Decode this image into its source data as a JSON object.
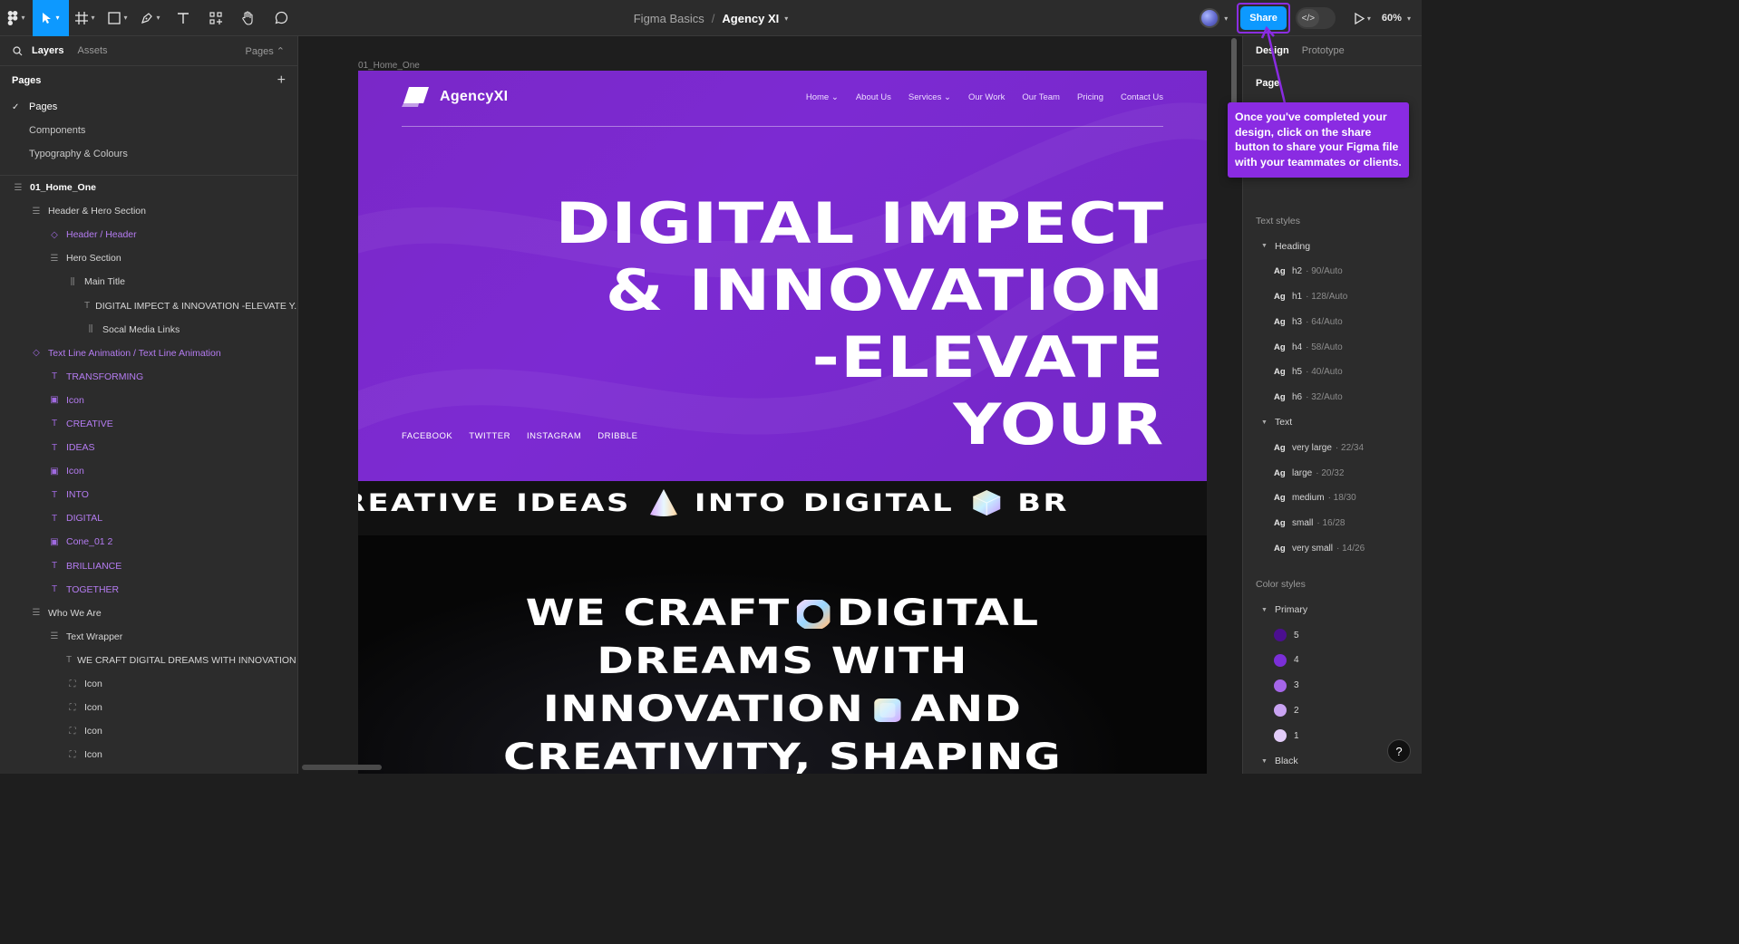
{
  "toolbar": {
    "breadcrumb_project": "Figma Basics",
    "breadcrumb_separator": "/",
    "file_name": "Agency XI",
    "share_label": "Share",
    "dev_mode_label": "</>",
    "zoom": "60%"
  },
  "left_panel": {
    "tab_layers": "Layers",
    "tab_assets": "Assets",
    "pages_dropdown": "Pages ⌃",
    "pages_heading": "Pages",
    "add_page": "+",
    "pages": [
      "Pages",
      "Components",
      "Typography & Colours"
    ],
    "selected_page_check": "✓",
    "layers": [
      {
        "label": "01_Home_One",
        "icon": "frame-icon",
        "indent": 0
      },
      {
        "label": "Header & Hero Section",
        "icon": "auto-layout-icon",
        "indent": 1
      },
      {
        "label": "Header / Header",
        "icon": "component-instance-icon",
        "indent": 2
      },
      {
        "label": "Hero Section",
        "icon": "auto-layout-icon",
        "indent": 2
      },
      {
        "label": "Main Title",
        "icon": "auto-layout-horizontal-icon",
        "indent": 3
      },
      {
        "label": "DIGITAL IMPECT & INNOVATION -ELEVATE Y...",
        "icon": "text-icon",
        "indent": 4
      },
      {
        "label": "Socal Media Links",
        "icon": "auto-layout-horizontal-icon",
        "indent": 4
      },
      {
        "label": "Text Line Animation / Text Line Animation",
        "icon": "component-instance-icon",
        "indent": 1
      },
      {
        "label": "TRANSFORMING",
        "icon": "text-icon",
        "indent": 2
      },
      {
        "label": "Icon",
        "icon": "image-icon",
        "indent": 2
      },
      {
        "label": "CREATIVE",
        "icon": "text-icon",
        "indent": 2
      },
      {
        "label": "IDEAS",
        "icon": "text-icon",
        "indent": 2
      },
      {
        "label": "Icon",
        "icon": "image-icon",
        "indent": 2
      },
      {
        "label": "INTO",
        "icon": "text-icon",
        "indent": 2
      },
      {
        "label": "DIGITAL",
        "icon": "text-icon",
        "indent": 2
      },
      {
        "label": "Cone_01 2",
        "icon": "image-icon",
        "indent": 2
      },
      {
        "label": "BRILLIANCE",
        "icon": "text-icon",
        "indent": 2
      },
      {
        "label": "TOGETHER",
        "icon": "text-icon",
        "indent": 2
      },
      {
        "label": "Who We Are",
        "icon": "auto-layout-icon",
        "indent": 1
      },
      {
        "label": "Text Wrapper",
        "icon": "auto-layout-icon",
        "indent": 2
      },
      {
        "label": "WE CRAFT DIGITAL DREAMS WITH INNOVATION ...",
        "icon": "text-icon",
        "indent": 3
      },
      {
        "label": "Icon",
        "icon": "image-frame-icon",
        "indent": 3
      },
      {
        "label": "Icon",
        "icon": "image-frame-icon",
        "indent": 3
      },
      {
        "label": "Icon",
        "icon": "image-frame-icon",
        "indent": 3
      },
      {
        "label": "Icon",
        "icon": "image-frame-icon",
        "indent": 3
      }
    ]
  },
  "canvas": {
    "frame_label": "01_Home_One",
    "site": {
      "logo_text": "AgencyXI",
      "nav": [
        "Home ⌄",
        "About Us",
        "Services ⌄",
        "Our Work",
        "Our Team",
        "Pricing",
        "Contact Us"
      ],
      "hero_lines": [
        "DIGITAL IMPECT",
        "& INNOVATION",
        "-ELEVATE",
        "YOUR"
      ],
      "socials": [
        "FACEBOOK",
        "TWITTER",
        "INSTAGRAM",
        "DRIBBLE"
      ],
      "marquee": [
        "REATIVE",
        "IDEAS",
        "INTO",
        "DIGITAL",
        "BR"
      ],
      "who_lines": [
        "WE CRAFT",
        "DIGITAL",
        "DREAMS WITH",
        "INNOVATION",
        "AND",
        "CREATIVITY, SHAPING"
      ]
    }
  },
  "right_panel": {
    "tab_design": "Design",
    "tab_prototype": "Prototype",
    "page_label": "Page",
    "text_styles_label": "Text styles",
    "heading_group": "Heading",
    "heading_styles": [
      {
        "name": "h2",
        "meta": "· 90/Auto"
      },
      {
        "name": "h1",
        "meta": "· 128/Auto"
      },
      {
        "name": "h3",
        "meta": "· 64/Auto"
      },
      {
        "name": "h4",
        "meta": "· 58/Auto"
      },
      {
        "name": "h5",
        "meta": "· 40/Auto"
      },
      {
        "name": "h6",
        "meta": "· 32/Auto"
      }
    ],
    "text_group": "Text",
    "text_styles": [
      {
        "name": "very large",
        "meta": "· 22/34"
      },
      {
        "name": "large",
        "meta": "· 20/32"
      },
      {
        "name": "medium",
        "meta": "· 18/30"
      },
      {
        "name": "small",
        "meta": "· 16/28"
      },
      {
        "name": "very small",
        "meta": "· 14/26"
      }
    ],
    "ag_glyph": "Ag",
    "color_styles_label": "Color styles",
    "primary_group": "Primary",
    "primary_colors": [
      {
        "name": "5",
        "hex": "#4b0f8f"
      },
      {
        "name": "4",
        "hex": "#7b2fd8"
      },
      {
        "name": "3",
        "hex": "#a566e8"
      },
      {
        "name": "2",
        "hex": "#c9a3f2"
      },
      {
        "name": "1",
        "hex": "#e2ccf8"
      }
    ],
    "black_group": "Black",
    "help": "?"
  },
  "tooltip": {
    "text": "Once you've completed your design, click on the share button to share your Figma file with your teammates or clients."
  },
  "colors": {
    "accent_blue": "#0d99ff",
    "tutorial_purple": "#8a2be2",
    "hero_purple": "#7b29cf"
  }
}
